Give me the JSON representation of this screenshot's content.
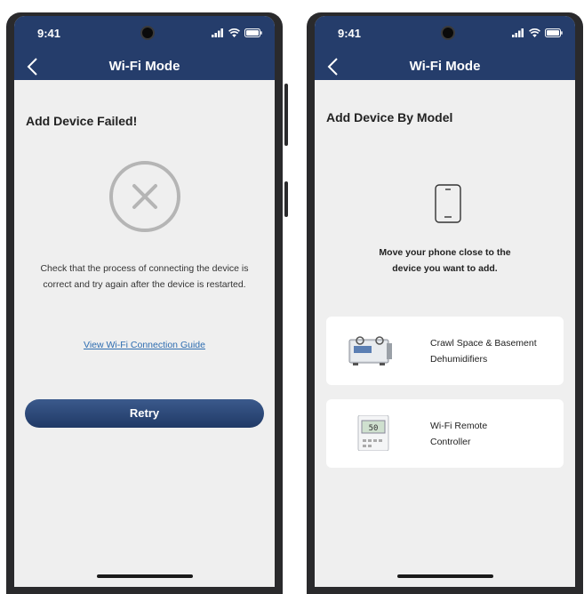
{
  "left_screen": {
    "status_time": "9:41",
    "nav_title": "Wi-Fi Mode",
    "heading": "Add Device Failed!",
    "message_line1": "Check that the process of connecting the device is",
    "message_line2": "correct and try again after the device is restarted.",
    "guide_link": "View Wi-Fi Connection Guide",
    "retry_label": "Retry"
  },
  "right_screen": {
    "status_time": "9:41",
    "nav_title": "Wi-Fi Mode",
    "heading": "Add Device By Model",
    "hint_line1": "Move your phone close to the",
    "hint_line2": "device you want to add.",
    "devices": [
      {
        "line1": "Crawl Space & Basement",
        "line2": "Dehumidifiers"
      },
      {
        "line1": "Wi-Fi Remote",
        "line2": "Controller"
      }
    ],
    "thermostat_display": "50"
  },
  "colors": {
    "header": "#253d6b",
    "link": "#2d6cb0",
    "background": "#efefef",
    "fail_icon": "#b5b5b5"
  },
  "icons": {
    "fail": "circle-x-icon",
    "phone": "phone-outline-icon",
    "back": "chevron-left-icon"
  }
}
